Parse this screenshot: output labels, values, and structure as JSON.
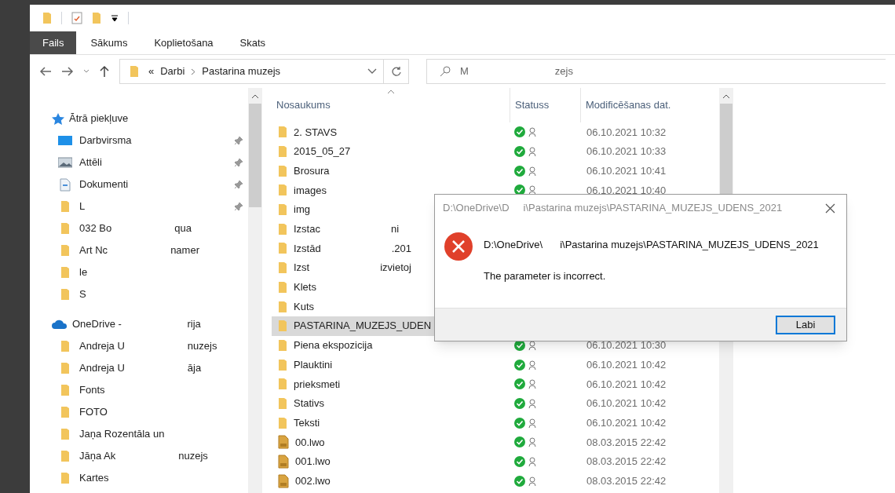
{
  "ribbon_tabs": [
    {
      "label": "Fails",
      "selected": true
    },
    {
      "label": "Sākums",
      "selected": false
    },
    {
      "label": "Koplietošana",
      "selected": false
    },
    {
      "label": "Skats",
      "selected": false
    }
  ],
  "address": {
    "overflow": "«",
    "crumbs": [
      "Darbi",
      "Pastarina muzejs"
    ]
  },
  "search": {
    "value_parts": [
      "M",
      "zejs"
    ]
  },
  "sidebar": {
    "sections": [
      {
        "kind": "quick",
        "label": "Ātrā piekļuve",
        "items": [
          {
            "kind": "desktop",
            "parts": [
              "Darbvirsma"
            ],
            "pinned": true
          },
          {
            "kind": "pictures",
            "parts": [
              "Attēli"
            ],
            "pinned": true
          },
          {
            "kind": "documents",
            "parts": [
              "Dokumenti"
            ],
            "pinned": true
          },
          {
            "kind": "folder",
            "parts": [
              "L"
            ],
            "pinned": true
          },
          {
            "kind": "folder",
            "parts": [
              "032 Bo",
              "qua"
            ],
            "pinned": false
          },
          {
            "kind": "folder",
            "parts": [
              "Art Nc",
              "namer"
            ],
            "pinned": false
          },
          {
            "kind": "folder",
            "parts": [
              "le"
            ],
            "pinned": false
          },
          {
            "kind": "folder",
            "parts": [
              "S"
            ],
            "pinned": false
          }
        ]
      },
      {
        "kind": "cloud",
        "label_parts": [
          "OneDrive - ",
          "rija"
        ],
        "items": [
          {
            "kind": "folder",
            "parts": [
              "Andreja U",
              "nuzejs"
            ],
            "pinned": false
          },
          {
            "kind": "folder",
            "parts": [
              "Andreja U",
              "āja"
            ],
            "pinned": false
          },
          {
            "kind": "folder",
            "parts": [
              "Fonts"
            ],
            "pinned": false
          },
          {
            "kind": "folder",
            "parts": [
              "FOTO"
            ],
            "pinned": false
          },
          {
            "kind": "folder",
            "parts": [
              "Jaņa Rozentāla un"
            ],
            "pinned": false
          },
          {
            "kind": "folder",
            "parts": [
              "Jāņa Ak",
              "nuzejs"
            ],
            "pinned": false
          },
          {
            "kind": "folder",
            "parts": [
              "Kartes"
            ],
            "pinned": false
          }
        ]
      }
    ]
  },
  "columns": [
    "Nosaukums",
    "Statuss",
    "Modificēšanas dat."
  ],
  "rows": [
    {
      "kind": "folder",
      "parts": [
        "2. STAVS"
      ],
      "date": "06.10.2021 10:32",
      "selected": false
    },
    {
      "kind": "folder",
      "parts": [
        "2015_05_27"
      ],
      "date": "06.10.2021 10:33",
      "selected": false
    },
    {
      "kind": "folder",
      "parts": [
        "Brosura"
      ],
      "date": "06.10.2021 10:41",
      "selected": false
    },
    {
      "kind": "folder",
      "parts": [
        "images"
      ],
      "date": "06.10.2021 10:40",
      "selected": false
    },
    {
      "kind": "folder",
      "parts": [
        "img"
      ],
      "selected": false
    },
    {
      "kind": "folder",
      "parts": [
        "Izstac",
        "ni"
      ],
      "selected": false
    },
    {
      "kind": "folder",
      "parts": [
        "Izstād",
        ".201"
      ],
      "selected": false
    },
    {
      "kind": "folder",
      "parts": [
        "Izst",
        "izvietoj"
      ],
      "selected": false
    },
    {
      "kind": "folder",
      "parts": [
        "Klets"
      ],
      "selected": false
    },
    {
      "kind": "folder",
      "parts": [
        "Kuts"
      ],
      "selected": false
    },
    {
      "kind": "folder",
      "parts": [
        "PASTARINA_MUZEJS_UDEN"
      ],
      "selected": true
    },
    {
      "kind": "folder",
      "parts": [
        "Piena ekspozicija"
      ],
      "date": "06.10.2021 10:30",
      "selected": false
    },
    {
      "kind": "folder",
      "parts": [
        "Plauktini"
      ],
      "date": "06.10.2021 10:42",
      "selected": false
    },
    {
      "kind": "folder",
      "parts": [
        "prieksmeti"
      ],
      "date": "06.10.2021 10:42",
      "selected": false
    },
    {
      "kind": "folder",
      "parts": [
        "Stativs"
      ],
      "date": "06.10.2021 10:42",
      "selected": false
    },
    {
      "kind": "folder",
      "parts": [
        "Teksti"
      ],
      "date": "06.10.2021 10:42",
      "selected": false
    },
    {
      "kind": "file",
      "parts": [
        "00.lwo"
      ],
      "date": "08.03.2015 22:42",
      "selected": false
    },
    {
      "kind": "file",
      "parts": [
        "001.lwo"
      ],
      "date": "08.03.2015 22:42",
      "selected": false
    },
    {
      "kind": "file",
      "parts": [
        "002.lwo"
      ],
      "date": "08.03.2015 22:42",
      "selected": false
    }
  ],
  "dialog": {
    "title_parts": [
      "D:\\OneDrive\\D",
      "i\\Pastarina muzejs\\PASTARINA_MUZEJS_UDENS_2021"
    ],
    "path_parts": [
      "D:\\OneDrive\\",
      "i\\Pastarina muzejs\\PASTARINA_MUZEJS_UDENS_2021"
    ],
    "message": "The parameter is incorrect.",
    "button": "Labi"
  }
}
